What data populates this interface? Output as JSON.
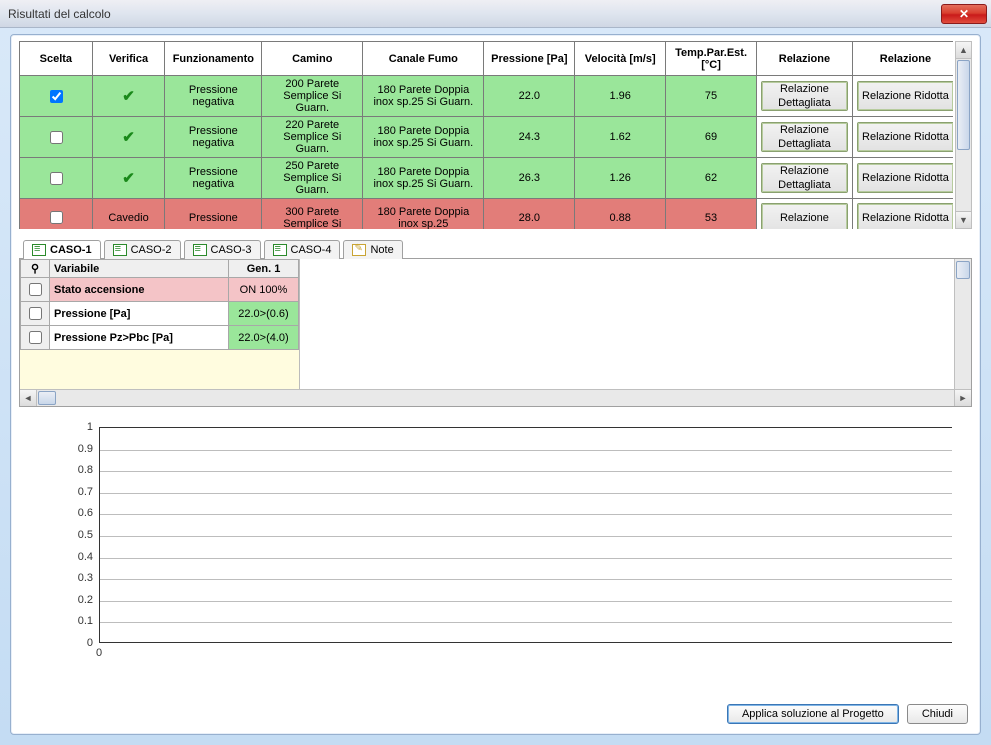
{
  "window": {
    "title": "Risultati del calcolo"
  },
  "table": {
    "headers": [
      "Scelta",
      "Verifica",
      "Funzionamento",
      "Camino",
      "Canale Fumo",
      "Pressione [Pa]",
      "Velocità [m/s]",
      "Temp.Par.Est. [°C]",
      "Relazione",
      "Relazione"
    ],
    "detailed_btn": "Relazione Dettagliata",
    "reduced_btn": "Relazione Ridotta",
    "rows": [
      {
        "status": "green",
        "checked": true,
        "verify": "ok",
        "funz": "Pressione negativa",
        "camino": "200 Parete Semplice Si Guarn.",
        "canale": "180 Parete Doppia inox sp.25 Si Guarn.",
        "press": "22.0",
        "vel": "1.96",
        "temp": "75"
      },
      {
        "status": "green",
        "checked": false,
        "verify": "ok",
        "funz": "Pressione negativa",
        "camino": "220 Parete Semplice Si Guarn.",
        "canale": "180 Parete Doppia inox sp.25 Si Guarn.",
        "press": "24.3",
        "vel": "1.62",
        "temp": "69"
      },
      {
        "status": "green",
        "checked": false,
        "verify": "ok",
        "funz": "Pressione negativa",
        "camino": "250 Parete Semplice Si Guarn.",
        "canale": "180 Parete Doppia inox sp.25 Si Guarn.",
        "press": "26.3",
        "vel": "1.26",
        "temp": "62"
      },
      {
        "status": "red",
        "checked": false,
        "verify": "Cavedio",
        "funz": "Pressione",
        "camino": "300 Parete Semplice Si",
        "canale": "180 Parete Doppia inox sp.25",
        "press": "28.0",
        "vel": "0.88",
        "temp": "53",
        "detailed_btn": "Relazione",
        "reduced_btn": "Relazione Ridotta"
      }
    ]
  },
  "tabs": [
    "CASO-1",
    "CASO-2",
    "CASO-3",
    "CASO-4",
    "Note"
  ],
  "vars": {
    "headers": [
      "Variabile",
      "Gen. 1"
    ],
    "rows": [
      {
        "kind": "pink",
        "name": "Stato accensione",
        "val": "ON 100%"
      },
      {
        "kind": "green",
        "name": "Pressione [Pa]",
        "val": "22.0>(0.6)"
      },
      {
        "kind": "green",
        "name": "Pressione Pz>Pbc [Pa]",
        "val": "22.0>(4.0)"
      }
    ]
  },
  "chart_data": {
    "type": "line",
    "title": "",
    "xlabel": "",
    "ylabel": "",
    "ylim": [
      0,
      1
    ],
    "yticks": [
      0,
      0.1,
      0.2,
      0.3,
      0.4,
      0.5,
      0.6,
      0.7,
      0.8,
      0.9,
      1
    ],
    "x": [
      0
    ],
    "series": []
  },
  "buttons": {
    "apply": "Applica soluzione al Progetto",
    "close": "Chiudi"
  }
}
